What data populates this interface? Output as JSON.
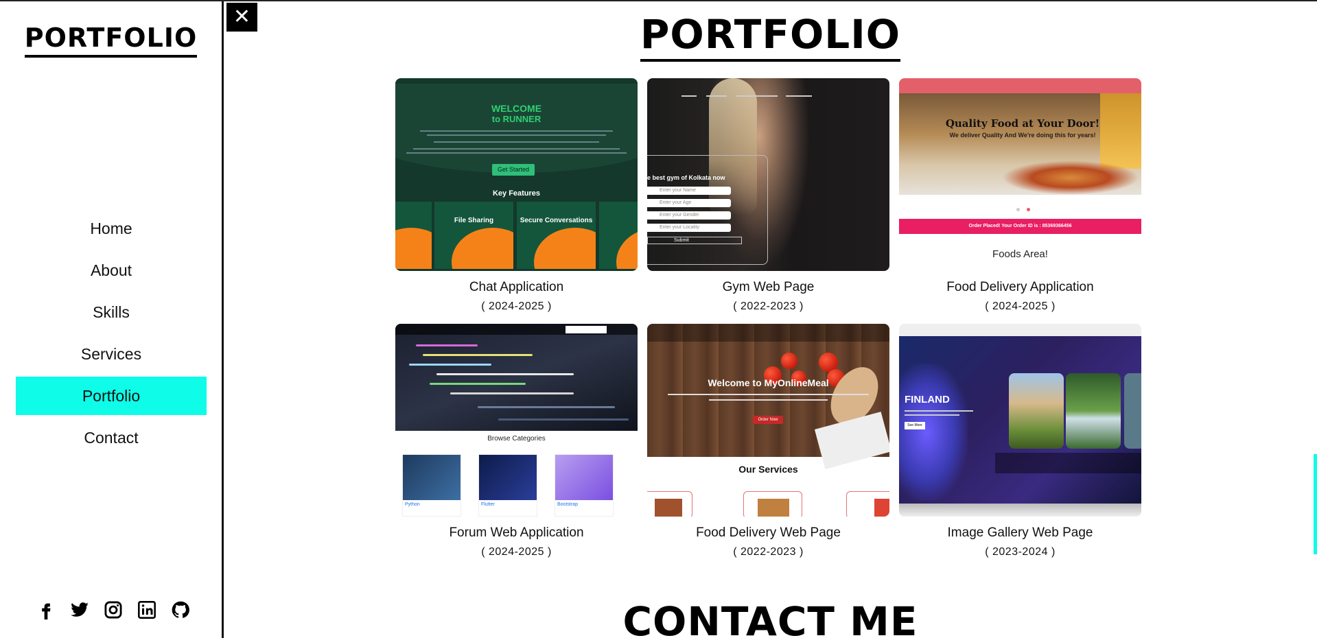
{
  "sidebar": {
    "brand": "PORTFOLIO",
    "nav": [
      {
        "label": "Home",
        "active": false
      },
      {
        "label": "About",
        "active": false
      },
      {
        "label": "Skills",
        "active": false
      },
      {
        "label": "Services",
        "active": false
      },
      {
        "label": "Portfolio",
        "active": true
      },
      {
        "label": "Contact",
        "active": false
      }
    ],
    "socials": [
      "facebook-icon",
      "twitter-icon",
      "instagram-icon",
      "linkedin-icon",
      "github-icon"
    ],
    "active_color": "#0efce8"
  },
  "close_button": "✕",
  "main": {
    "title": "PORTFOLIO",
    "projects": [
      {
        "title": "Chat Application",
        "years": "( 2024-2025 )"
      },
      {
        "title": "Gym Web Page",
        "years": "( 2022-2023 )"
      },
      {
        "title": "Food Delivery Application",
        "years": "( 2024-2025 )"
      },
      {
        "title": "Forum Web Application",
        "years": "( 2024-2025 )"
      },
      {
        "title": "Food Delivery Web Page",
        "years": "( 2022-2023 )"
      },
      {
        "title": "Image Gallery Web Page",
        "years": "( 2023-2024 )"
      }
    ],
    "next_section_title": "CONTACT ME"
  },
  "thumbs": {
    "chat": {
      "welcome": "WELCOME",
      "runner": "to RUNNER",
      "get_started": "Get Started",
      "key_features": "Key Features",
      "features": [
        "File Sharing",
        "Secure Conversations"
      ]
    },
    "gym": {
      "form_title": "e best gym of Kolkata now",
      "fields": [
        "Enter your Name",
        "Enter your Age",
        "Enter your Gender",
        "Enter your Locality"
      ],
      "submit": "Submit"
    },
    "food": {
      "headline": "Quality Food at Your Door!",
      "sub": "We deliver Quality And We're doing this for years!",
      "order_bar": "Order Placed! Your Order ID is : 85369366456",
      "area": "Foods Area!"
    },
    "forum": {
      "browse": "Browse Categories",
      "cards": [
        "Python",
        "Flutter",
        "Bootstrap"
      ]
    },
    "meal": {
      "headline": "Welcome to MyOnlineMeal",
      "order": "Order Now",
      "services": "Our Services"
    },
    "gallery": {
      "country": "FINLAND",
      "see_more": "See More"
    }
  }
}
